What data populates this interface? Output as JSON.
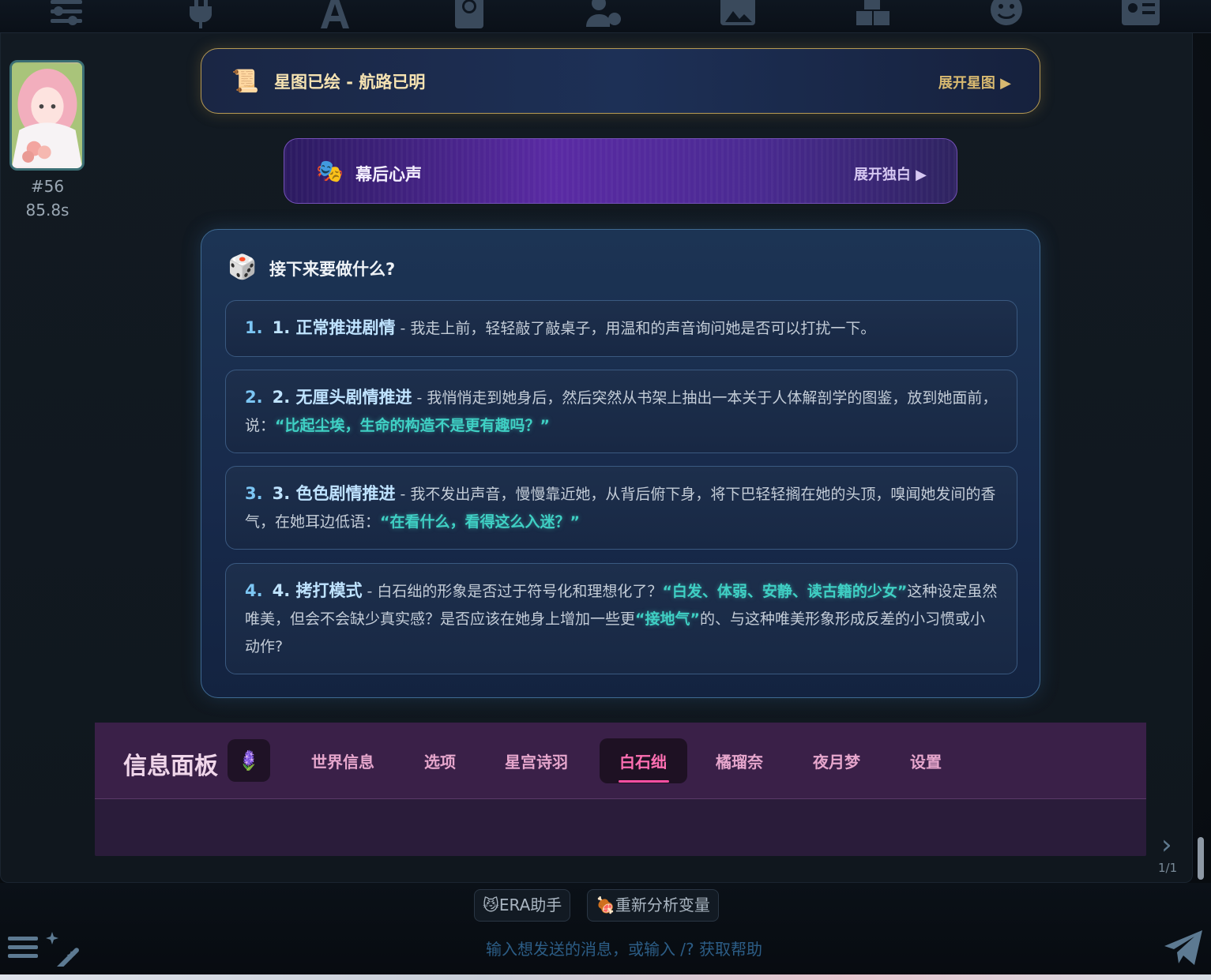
{
  "toolbar": {
    "icons": [
      "sliders-icon",
      "plug-icon",
      "font-icon",
      "book-globe-icon",
      "user-gear-icon",
      "image-icon",
      "cubes-icon",
      "smile-icon",
      "id-card-icon"
    ]
  },
  "message": {
    "id": "#56",
    "time": "85.8s"
  },
  "starmap": {
    "icon": "📜",
    "title": "星图已绘 - 航路已明",
    "toggle": "展开星图 ▶"
  },
  "monologue": {
    "icon": "🎭",
    "title": "幕后心声",
    "toggle": "展开独白 ▶"
  },
  "options": {
    "icon": "🎲",
    "title": "接下来要做什么?",
    "items": [
      {
        "num": "1.",
        "name": "1. 正常推进剧情",
        "text": " - 我走上前，轻轻敲了敲桌子，用温和的声音询问她是否可以打扰一下。",
        "quote": "",
        "tail": ""
      },
      {
        "num": "2.",
        "name": "2. 无厘头剧情推进",
        "text": " - 我悄悄走到她身后，然后突然从书架上抽出一本关于人体解剖学的图鉴，放到她面前，说：",
        "quote": "“比起尘埃，生命的构造不是更有趣吗？”",
        "tail": ""
      },
      {
        "num": "3.",
        "name": "3. 色色剧情推进",
        "text": " - 我不发出声音，慢慢靠近她，从背后俯下身，将下巴轻轻搁在她的头顶，嗅闻她发间的香气，在她耳边低语：",
        "quote": "“在看什么，看得这么入迷？”",
        "tail": ""
      },
      {
        "num": "4.",
        "name": "4. 拷打模式",
        "text": " - 白石绌的形象是否过于符号化和理想化了？",
        "quote": "“白发、体弱、安静、读古籍的少女”",
        "tail": "这种设定虽然唯美，但会不会缺少真实感？是否应该在她身上增加一些更",
        "quote2": "“接地气”",
        "tail2": "的、与这种唯美形象形成反差的小习惯或小动作?"
      }
    ]
  },
  "panel": {
    "title": "信息面板",
    "icon": "🪻",
    "tabs": [
      "世界信息",
      "选项",
      "星宫诗羽",
      "白石绌",
      "橘瑠奈",
      "夜月梦",
      "设置"
    ],
    "active_tab": "白石绌"
  },
  "pager": {
    "text": "1/1"
  },
  "bottom": {
    "chips": [
      {
        "icon": "😼",
        "label": "ERA助手"
      },
      {
        "icon": "🍖",
        "label": "重新分析变量"
      }
    ],
    "placeholder": "输入想发送的消息，或输入 /? 获取帮助"
  },
  "colors": {
    "gold_border": "#b69a54",
    "purple_card": "#5a2aa4",
    "option_accent": "#7cc6f4",
    "quote": "#3fd0c4",
    "panel_bg": "#3a2048",
    "active_tab": "#ff6fb2"
  }
}
